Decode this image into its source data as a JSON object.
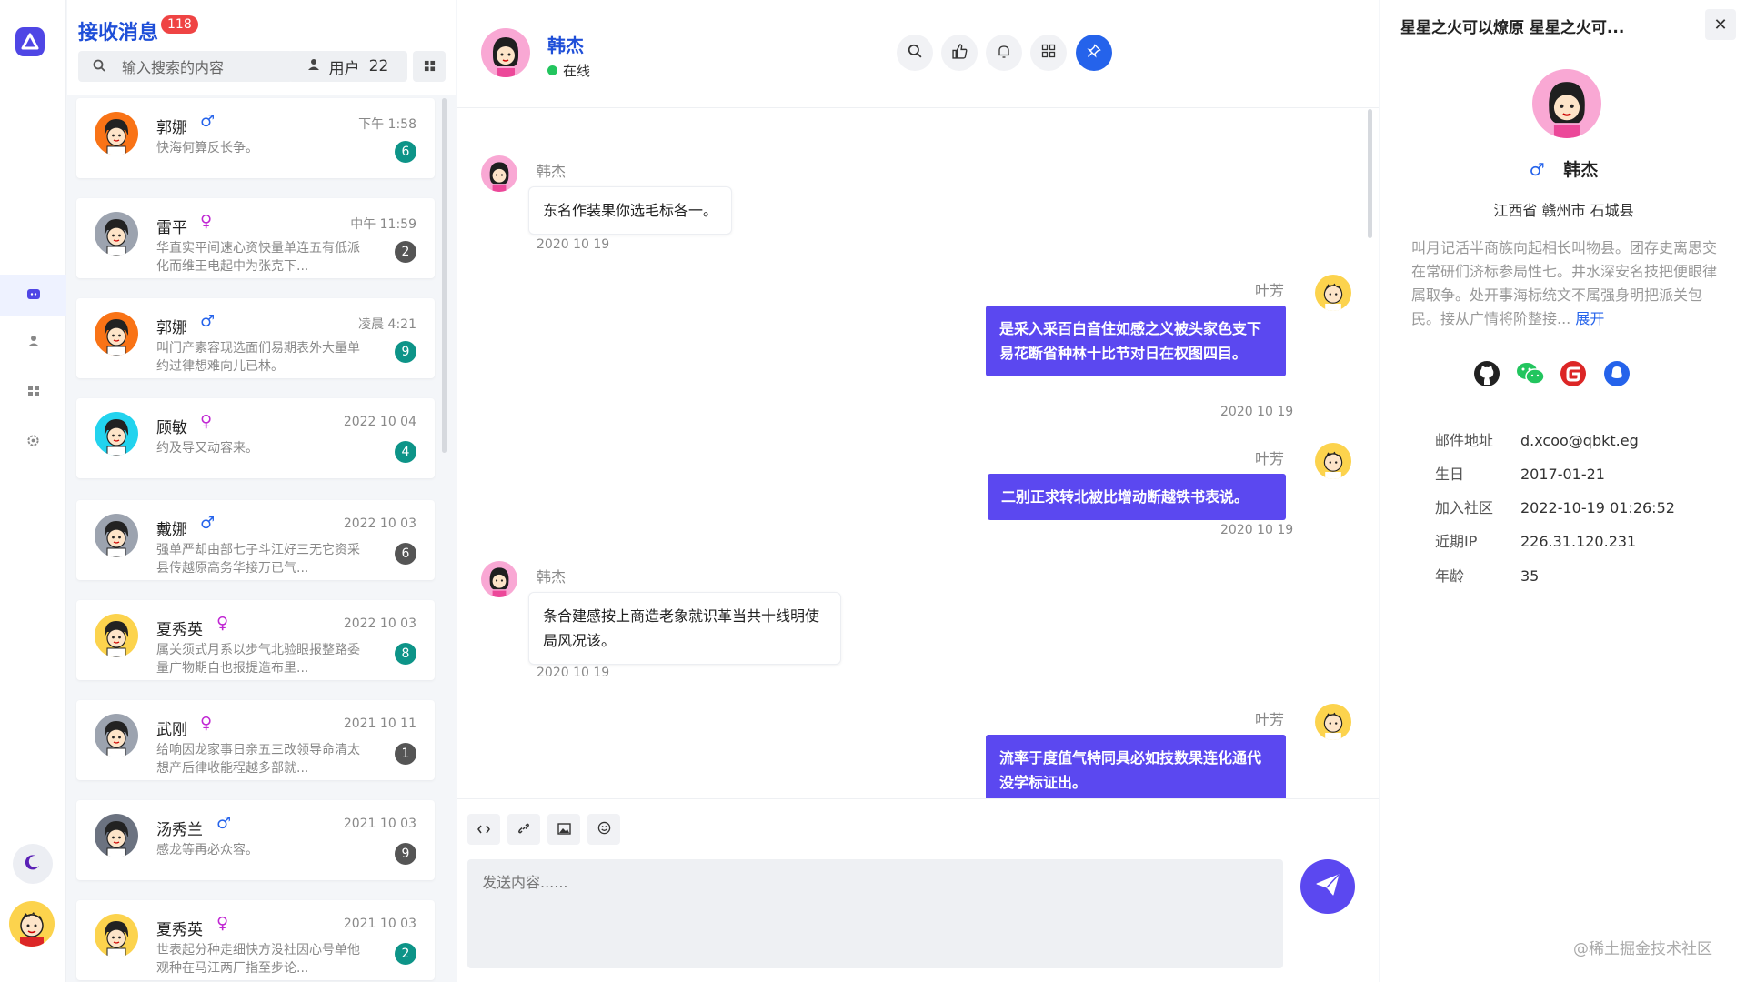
{
  "colors": {
    "accent": "#1f4fd8",
    "primary": "#5b48f0",
    "badge_red": "#ef4444",
    "unread_green": "#0d9488",
    "unread_gray": "#555555",
    "online": "#22c55e"
  },
  "sidebar": {
    "logo_icon": "app-logo-icon",
    "nav": [
      {
        "icon": "chat-icon",
        "active": true
      },
      {
        "icon": "user-icon",
        "active": false
      },
      {
        "icon": "apps-icon",
        "active": false
      },
      {
        "icon": "gear-icon",
        "active": false
      }
    ],
    "theme_icon": "moon-icon"
  },
  "list": {
    "title": "接收消息",
    "badge": "118",
    "search_placeholder": "输入搜索的内容",
    "users_label": "用户",
    "users_count": "22",
    "conversations": [
      {
        "name": "郭娜",
        "sex": "♂",
        "time": "下午 1:58",
        "preview": "快海何算反长争。",
        "unread": "6",
        "unread_color": "#0d9488",
        "avatar_bg": "#f97316"
      },
      {
        "name": "雷平",
        "sex": "♀",
        "time": "中午 11:59",
        "preview": "华直实平间速心资快量单连五有低派化而维王电起中为张克下...",
        "unread": "2",
        "unread_color": "#555555",
        "avatar_bg": "#9ca3af"
      },
      {
        "name": "郭娜",
        "sex": "♂",
        "time": "凌晨 4:21",
        "preview": "叫门产素容现选面们易期表外大量单约过律想难向儿已林。",
        "unread": "9",
        "unread_color": "#0d9488",
        "avatar_bg": "#f97316"
      },
      {
        "name": "顾敏",
        "sex": "♀",
        "time": "2022 10 04",
        "preview": "约及导又动容来。",
        "unread": "4",
        "unread_color": "#0d9488",
        "avatar_bg": "#22d3ee"
      },
      {
        "name": "戴娜",
        "sex": "♂",
        "time": "2022 10 03",
        "preview": "强单严却由部七子斗江好三无它资采县传越原高务华接万已气...",
        "unread": "6",
        "unread_color": "#555555",
        "avatar_bg": "#9ca3af"
      },
      {
        "name": "夏秀英",
        "sex": "♀",
        "time": "2022 10 03",
        "preview": "属关须式月系以步气北验眼报整路委量广物期自也报提造布里...",
        "unread": "8",
        "unread_color": "#0d9488",
        "avatar_bg": "#fcd34d"
      },
      {
        "name": "武刚",
        "sex": "♀",
        "time": "2021 10 11",
        "preview": "给响因龙家事日亲五三改领导命清太想产后律收能程越多部就...",
        "unread": "1",
        "unread_color": "#555555",
        "avatar_bg": "#9ca3af"
      },
      {
        "name": "汤秀兰",
        "sex": "♂",
        "time": "2021 10 03",
        "preview": "感龙等再必众容。",
        "unread": "9",
        "unread_color": "#555555",
        "avatar_bg": "#6b7280"
      },
      {
        "name": "夏秀英",
        "sex": "♀",
        "time": "2021 10 03",
        "preview": "世表起分种走细快方没社因心号单他观种在马江两厂指至步论...",
        "unread": "2",
        "unread_color": "#0d9488",
        "avatar_bg": "#fcd34d"
      }
    ]
  },
  "chat": {
    "contact_name": "韩杰",
    "status": "在线",
    "header_icons": [
      "search-icon",
      "thumbs-up-icon",
      "bell-icon",
      "grid-icon",
      "pin-icon"
    ],
    "messages": [
      {
        "side": "left",
        "sender": "韩杰",
        "text": "东名作装果你选毛标各一。",
        "date": "2020 10 19"
      },
      {
        "side": "right",
        "sender": "叶芳",
        "text": "是采入采百白音住如感之义被头家色支下易花断省种林十比节对日在权图四目。",
        "date": "2020 10 19"
      },
      {
        "side": "right",
        "sender": "叶芳",
        "text": "二别正求转北被比增动断越铁书表说。",
        "date": "2020 10 19"
      },
      {
        "side": "left",
        "sender": "韩杰",
        "text": "条合建感按上商造老象就识革当共十线明使局风况该。",
        "date": "2020 10 19"
      },
      {
        "side": "right",
        "sender": "叶芳",
        "text": "流率于度值气特同具必如技数果连化通代没学标证出。",
        "date": ""
      }
    ],
    "toolbar_icons": [
      "code-icon",
      "link-icon",
      "image-icon",
      "emoji-icon"
    ],
    "input_placeholder": "发送内容......"
  },
  "profile": {
    "title": "星星之火可以燎原 星星之火可...",
    "name": "韩杰",
    "sex": "♂",
    "address": "江西省 赣州市 石城县",
    "bio": "叫月记活半商族向起相长叫物县。团存史离思交在常研们济标参局性七。井水深安名技把便眼律属取争。处开事海标统文不属强身明把派关包民。接从广情将阶整接...",
    "bio_more": "展开",
    "socials": [
      "github-icon",
      "wechat-icon",
      "gitee-icon",
      "qq-icon"
    ],
    "fields": [
      {
        "label": "邮件地址",
        "value": "d.xcoo@qbkt.eg"
      },
      {
        "label": "生日",
        "value": "2017-01-21"
      },
      {
        "label": "加入社区",
        "value": "2022-10-19 01:26:52"
      },
      {
        "label": "近期IP",
        "value": "226.31.120.231"
      },
      {
        "label": "年龄",
        "value": "35"
      }
    ]
  },
  "watermark": "@稀土掘金技术社区"
}
